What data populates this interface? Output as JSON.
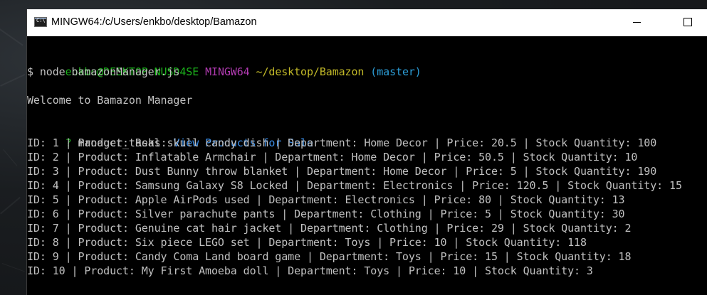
{
  "window": {
    "title": "MINGW64:/c/Users/enkbo/desktop/Bamazon",
    "icon_label": "C:\\"
  },
  "prompt": {
    "user_host": "enkbo@DESKTOP-NUSD4SE",
    "shell": "MINGW64",
    "path": "~/desktop/Bamazon",
    "branch": "(master)",
    "command": "$ node bamazonManager.js"
  },
  "welcome": "Welcome to Bamazon Manager",
  "question": {
    "mark": "?",
    "key": "manager_tasks:",
    "answer": "View Products for Sale"
  },
  "products": [
    "ID: 1 | Product: Real skull candy dish | Department: Home Decor | Price: 20.5 | Stock Quantity: 100",
    "ID: 2 | Product: Inflatable Armchair | Department: Home Decor | Price: 50.5 | Stock Quantity: 10",
    "ID: 3 | Product: Dust Bunny throw blanket | Department: Home Decor | Price: 5 | Stock Quantity: 190",
    "ID: 4 | Product: Samsung Galaxy S8 Locked | Department: Electronics | Price: 120.5 | Stock Quantity: 15",
    "ID: 5 | Product: Apple AirPods used | Department: Electronics | Price: 80 | Stock Quantity: 13",
    "ID: 6 | Product: Silver parachute pants | Department: Clothing | Price: 5 | Stock Quantity: 30",
    "ID: 7 | Product: Genuine cat hair jacket | Department: Clothing | Price: 29 | Stock Quantity: 2",
    "ID: 8 | Product: Six piece LEGO set | Department: Toys | Price: 10 | Stock Quantity: 118",
    "ID: 9 | Product: Candy Coma Land board game | Department: Toys | Price: 15 | Stock Quantity: 18",
    "ID: 10 | Product: My First Amoeba doll | Department: Toys | Price: 10 | Stock Quantity: 3"
  ],
  "colors": {
    "background": "#000000",
    "text": "#c0c0c0",
    "user_host": "#1cb21c",
    "shell": "#b13bb1",
    "path": "#c2b928",
    "branch": "#2c9ed8",
    "answer": "#3b8ee8"
  }
}
